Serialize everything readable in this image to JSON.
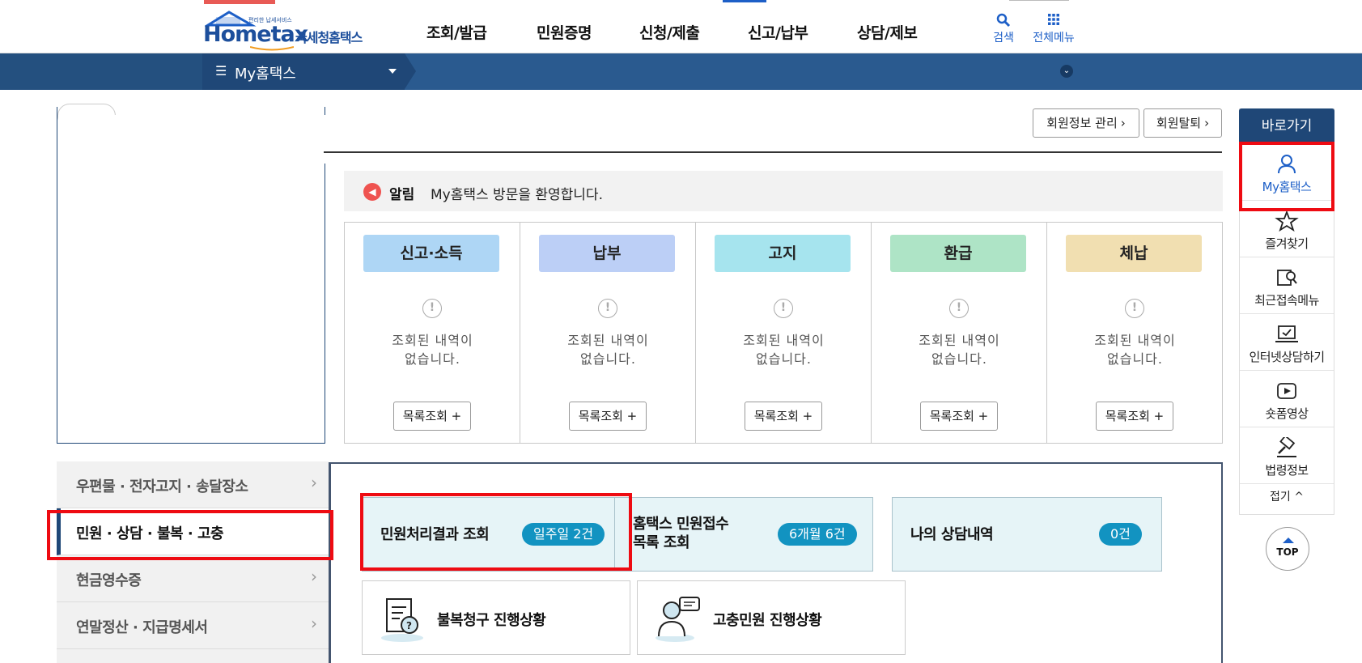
{
  "header": {
    "logo_main": "Hometax",
    "logo_sub": "국세청홈택스",
    "logo_tiny": "편리한 납세서비스",
    "nav": [
      "조회/발급",
      "민원증명",
      "신청/제출",
      "신고/납부",
      "상담/제보"
    ],
    "search_label": "검색",
    "allmenu_label": "전체메뉴"
  },
  "subbar": {
    "menu_label": "My홈택스"
  },
  "top_buttons": {
    "member_info": "회원정보 관리",
    "withdraw": "회원탈퇴"
  },
  "alert": {
    "label": "알림",
    "message": "My홈택스 방문을 환영합니다."
  },
  "categories": [
    {
      "label": "신고·소득",
      "empty": "조회된 내역이\n없습니다.",
      "button": "목록조회 +",
      "color": "#aed6f5"
    },
    {
      "label": "납부",
      "empty": "조회된 내역이\n없습니다.",
      "button": "목록조회 +",
      "color": "#bccff6"
    },
    {
      "label": "고지",
      "empty": "조회된 내역이\n없습니다.",
      "button": "목록조회 +",
      "color": "#a6e4ee"
    },
    {
      "label": "환급",
      "empty": "조회된 내역이\n없습니다.",
      "button": "목록조회 +",
      "color": "#aee4c6"
    },
    {
      "label": "체납",
      "empty": "조회된 내역이\n없습니다.",
      "button": "목록조회 +",
      "color": "#f1dfb1"
    }
  ],
  "side_menu": [
    {
      "label": "우편물 · 전자고지 · 송달장소",
      "active": false
    },
    {
      "label": "민원 · 상담 · 불복 · 고충",
      "active": true
    },
    {
      "label": "현금영수증",
      "active": false
    },
    {
      "label": "연말정산 · 지급명세서",
      "active": false
    }
  ],
  "cards": {
    "civil_result": {
      "title": "민원처리결과 조회",
      "count": "일주일 2건"
    },
    "hometax_receipt": {
      "title_line1": "홈택스 민원접수",
      "title_line2": "목록 조회",
      "count": "6개월 6건"
    },
    "my_consult": {
      "title": "나의 상담내역",
      "count": "0건"
    },
    "appeal": {
      "title": "불복청구 진행상황"
    },
    "grievance": {
      "title": "고충민원 진행상황"
    }
  },
  "quick_menu": {
    "title": "바로가기",
    "items": [
      {
        "label": "My홈택스",
        "icon": "person-icon"
      },
      {
        "label": "즐겨찾기",
        "icon": "star-icon"
      },
      {
        "label": "최근접속메뉴",
        "icon": "recent-search-icon"
      },
      {
        "label": "인터넷상담하기",
        "icon": "monitor-chat-icon"
      },
      {
        "label": "숏폼영상",
        "icon": "play-icon"
      },
      {
        "label": "법령정보",
        "icon": "gavel-icon"
      }
    ],
    "fold": "접기 ^",
    "top": "TOP"
  },
  "colors": {
    "navy": "#1f4777",
    "accent_blue": "#1d5fc7",
    "highlight_red": "#ee0b12",
    "count_badge": "#1293c1"
  }
}
